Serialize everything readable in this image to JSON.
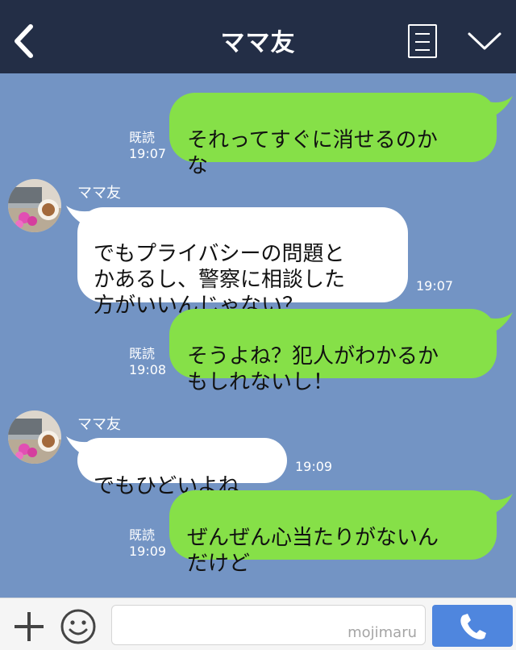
{
  "header": {
    "title": "ママ友",
    "back_icon": "chevron-left-icon",
    "menu_icon": "list-menu-icon",
    "dropdown_icon": "chevron-down-icon"
  },
  "colors": {
    "header_bg": "#232e46",
    "chat_bg": "#7394c4",
    "sent_bubble": "#86e048",
    "received_bubble": "#ffffff",
    "call_button": "#4f86de"
  },
  "messages": [
    {
      "direction": "sent",
      "text": "それってすぐに消せるのか\nな",
      "read": "既読",
      "time": "19:07"
    },
    {
      "direction": "received",
      "sender": "ママ友",
      "text": "でもプライバシーの問題と\nかあるし、警察に相談した\n方がいいんじゃない？",
      "time": "19:07"
    },
    {
      "direction": "sent",
      "text": "そうよね？犯人がわかるか\nもしれないし！",
      "read": "既読",
      "time": "19:08"
    },
    {
      "direction": "received",
      "sender": "ママ友",
      "text": "でもひどいよね",
      "time": "19:09"
    },
    {
      "direction": "sent",
      "text": "ぜんぜん心当たりがないん\nだけど",
      "read": "既読",
      "time": "19:09"
    }
  ],
  "footer": {
    "plus_icon": "plus-icon",
    "emoji_icon": "smiley-icon",
    "input_value": "",
    "watermark": "mojimaru",
    "call_icon": "phone-icon"
  }
}
